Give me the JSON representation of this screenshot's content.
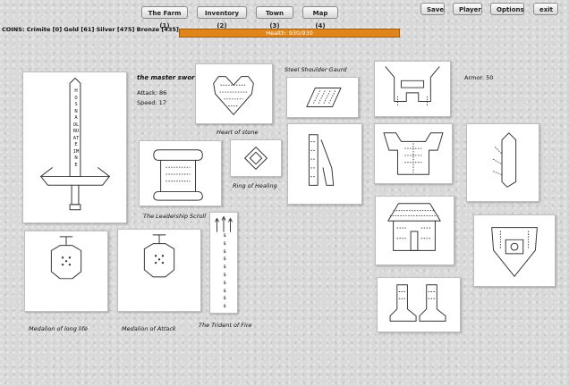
{
  "nav": {
    "farm": "The Farm (1)",
    "inventory": "Inventory (2)",
    "town": "Town (3)",
    "map": "Map (4)",
    "save": "Save",
    "player": "Player",
    "options": "Options",
    "exit": "exit"
  },
  "coins": "COINS: Crimite [0]  Gold [61]  Silver [475]  Bronze [435]",
  "health": "Health: 930/930",
  "items": {
    "sword": {
      "name": "the master sword",
      "attack": "Attack: 86",
      "speed": "Speed: 17",
      "letters": "H\nO\nS\nN\nA\nOL\nRU\nAT\nE\nIM\nN\nE"
    },
    "heart": "Heart of stone",
    "shoulder": "Steel Shoulder Gaurd",
    "armor_stat": "Armor: 50",
    "scroll": "The Leadership Scroll",
    "ring": "Ring of Healing",
    "med_life": "Medalion of long life",
    "med_attack": "Medalion of Attack",
    "trident": "The Trident of Fire",
    "trident_glyphs": "$\n$\n$\n$\n$\n$\n$\n$\n$\n$"
  }
}
